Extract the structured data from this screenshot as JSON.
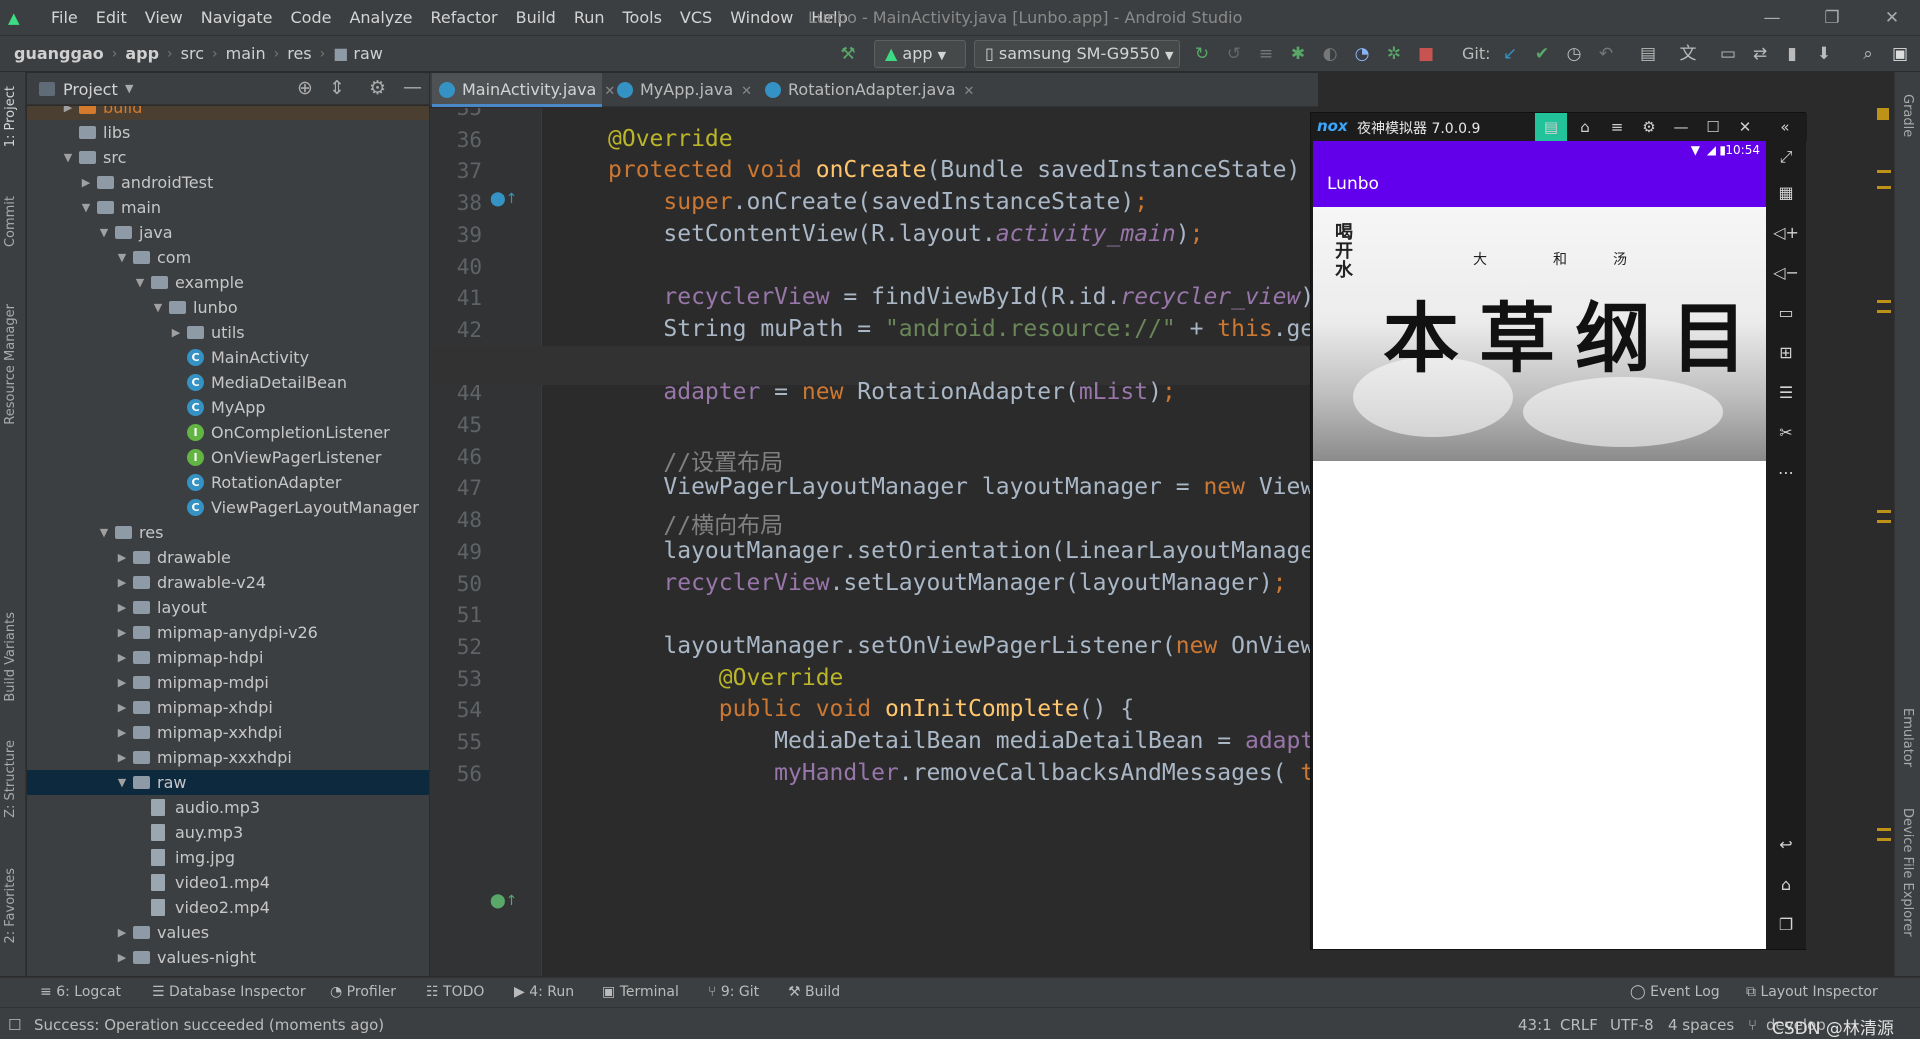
{
  "window": {
    "title": "Lunbo - MainActivity.java [Lunbo.app] - Android Studio",
    "menu": [
      "File",
      "Edit",
      "View",
      "Navigate",
      "Code",
      "Analyze",
      "Refactor",
      "Build",
      "Run",
      "Tools",
      "VCS",
      "Window",
      "Help"
    ]
  },
  "nav": {
    "breadcrumb": [
      "guanggao",
      "app",
      "src",
      "main",
      "res",
      "raw"
    ],
    "run_config": "app",
    "device": "samsung SM-G9550",
    "git_label": "Git:"
  },
  "left_strip": [
    "1: Project",
    "Commit",
    "Resource Manager",
    "Build Variants",
    "Z: Structure",
    "2: Favorites"
  ],
  "right_strip": [
    "Gradle",
    "Emulator",
    "Device File Explorer"
  ],
  "project_panel": {
    "title": "Project",
    "tree": [
      {
        "label": "build",
        "kind": "folder-orange",
        "depth": 2,
        "arrow": "right",
        "highlight": true
      },
      {
        "label": "libs",
        "kind": "folder",
        "depth": 2,
        "arrow": ""
      },
      {
        "label": "src",
        "kind": "folder",
        "depth": 2,
        "arrow": "down"
      },
      {
        "label": "androidTest",
        "kind": "folder",
        "depth": 3,
        "arrow": "right"
      },
      {
        "label": "main",
        "kind": "folder",
        "depth": 3,
        "arrow": "down"
      },
      {
        "label": "java",
        "kind": "folder",
        "depth": 4,
        "arrow": "down"
      },
      {
        "label": "com",
        "kind": "folder",
        "depth": 5,
        "arrow": "down"
      },
      {
        "label": "example",
        "kind": "folder",
        "depth": 6,
        "arrow": "down"
      },
      {
        "label": "lunbo",
        "kind": "folder",
        "depth": 7,
        "arrow": "down"
      },
      {
        "label": "utils",
        "kind": "folder",
        "depth": 8,
        "arrow": "right"
      },
      {
        "label": "MainActivity",
        "kind": "class",
        "depth": 8,
        "arrow": ""
      },
      {
        "label": "MediaDetailBean",
        "kind": "class",
        "depth": 8,
        "arrow": ""
      },
      {
        "label": "MyApp",
        "kind": "class",
        "depth": 8,
        "arrow": ""
      },
      {
        "label": "OnCompletionListener",
        "kind": "interface",
        "depth": 8,
        "arrow": ""
      },
      {
        "label": "OnViewPagerListener",
        "kind": "interface",
        "depth": 8,
        "arrow": ""
      },
      {
        "label": "RotationAdapter",
        "kind": "class",
        "depth": 8,
        "arrow": ""
      },
      {
        "label": "ViewPagerLayoutManager",
        "kind": "class",
        "depth": 8,
        "arrow": ""
      },
      {
        "label": "res",
        "kind": "folder",
        "depth": 4,
        "arrow": "down"
      },
      {
        "label": "drawable",
        "kind": "folder",
        "depth": 5,
        "arrow": "right"
      },
      {
        "label": "drawable-v24",
        "kind": "folder",
        "depth": 5,
        "arrow": "right"
      },
      {
        "label": "layout",
        "kind": "folder",
        "depth": 5,
        "arrow": "right"
      },
      {
        "label": "mipmap-anydpi-v26",
        "kind": "folder",
        "depth": 5,
        "arrow": "right"
      },
      {
        "label": "mipmap-hdpi",
        "kind": "folder",
        "depth": 5,
        "arrow": "right"
      },
      {
        "label": "mipmap-mdpi",
        "kind": "folder",
        "depth": 5,
        "arrow": "right"
      },
      {
        "label": "mipmap-xhdpi",
        "kind": "folder",
        "depth": 5,
        "arrow": "right"
      },
      {
        "label": "mipmap-xxhdpi",
        "kind": "folder",
        "depth": 5,
        "arrow": "right"
      },
      {
        "label": "mipmap-xxxhdpi",
        "kind": "folder",
        "depth": 5,
        "arrow": "right"
      },
      {
        "label": "raw",
        "kind": "folder",
        "depth": 5,
        "arrow": "down",
        "selected": true
      },
      {
        "label": "audio.mp3",
        "kind": "file",
        "depth": 6,
        "arrow": ""
      },
      {
        "label": "auy.mp3",
        "kind": "file",
        "depth": 6,
        "arrow": ""
      },
      {
        "label": "img.jpg",
        "kind": "file",
        "depth": 6,
        "arrow": ""
      },
      {
        "label": "video1.mp4",
        "kind": "file",
        "depth": 6,
        "arrow": ""
      },
      {
        "label": "video2.mp4",
        "kind": "file",
        "depth": 6,
        "arrow": ""
      },
      {
        "label": "values",
        "kind": "folder",
        "depth": 5,
        "arrow": "right"
      },
      {
        "label": "values-night",
        "kind": "folder",
        "depth": 5,
        "arrow": "right"
      }
    ]
  },
  "editor": {
    "tabs": [
      {
        "label": "MainActivity.java",
        "active": true
      },
      {
        "label": "MyApp.java",
        "active": false
      },
      {
        "label": "RotationAdapter.java",
        "active": false
      }
    ],
    "current_line": 43,
    "lines": [
      {
        "n": 35,
        "html": ""
      },
      {
        "n": 36,
        "html": "<span class='an'>@Override</span>"
      },
      {
        "n": 37,
        "html": "<span class='k'>protected void </span><span class='fn'>onCreate</span>(Bundle savedInstanceState) {"
      },
      {
        "n": 38,
        "html": "    <span class='k'>super</span>.onCreate(savedInstanceState)<span class='k'>;</span>"
      },
      {
        "n": 39,
        "html": "    setContentView(R.layout.<span class='fld it'>activity_main</span>)<span class='k'>;</span>"
      },
      {
        "n": 40,
        "html": ""
      },
      {
        "n": 41,
        "html": "    <span class='fld'>recyclerView</span> = findViewById(R.id.<span class='fld it'>recycler_view</span>)<span class='k'>;</span>"
      },
      {
        "n": 42,
        "html": "    String muPath = <span class='str'>\"android.resource://\"</span> + <span class='k'>this</span>.getPackageName()"
      },
      {
        "n": 43,
        "html": ""
      },
      {
        "n": 44,
        "html": "    <span class='fld'>adapter</span> = <span class='k'>new </span>RotationAdapter(<span class='fld'>mList</span>)<span class='k'>;</span>"
      },
      {
        "n": 45,
        "html": ""
      },
      {
        "n": 46,
        "html": "    <span class='cm'>//设置布局</span>"
      },
      {
        "n": 47,
        "html": "    ViewPagerLayoutManager layoutManager = <span class='k'>new </span>ViewPagerLayoutManager("
      },
      {
        "n": 48,
        "html": "    <span class='cm'>//横向布局</span>"
      },
      {
        "n": 49,
        "html": "    layoutManager.setOrientation(LinearLayoutManager.<span class='fld it'>HORIZONTAL</span>)<span class='k'>;</span>"
      },
      {
        "n": 50,
        "html": "    <span class='fld'>recyclerView</span>.setLayoutManager(layoutManager)<span class='k'>;</span>"
      },
      {
        "n": 51,
        "html": ""
      },
      {
        "n": 52,
        "html": "    layoutManager.setOnViewPagerListener(<span class='k'>new </span>OnViewPagerListener() {"
      },
      {
        "n": 53,
        "html": "        <span class='an'>@Override</span>"
      },
      {
        "n": 54,
        "html": "        <span class='k'>public void </span><span class='fn'>onInitComplete</span>() {"
      },
      {
        "n": 55,
        "html": "            MediaDetailBean mediaDetailBean = <span class='fld'>adapter</span>.getItem("
      },
      {
        "n": 56,
        "html": "            <span class='fld'>myHandler</span>.removeCallbacksAndMessages( <span class='k'>t</span>"
      }
    ]
  },
  "emulator": {
    "brand": "nox",
    "name": "夜神模拟器 7.0.0.9",
    "time": "10:54",
    "app_title": "Lunbo",
    "banner": {
      "main_text": "本草纲目",
      "small_texts": [
        "大",
        "和",
        "汤"
      ],
      "side_text": "喝开水"
    }
  },
  "bottom_tools": [
    "6: Logcat",
    "Database Inspector",
    "Profiler",
    "TODO",
    "4: Run",
    "Terminal",
    "9: Git",
    "Build"
  ],
  "bottom_tools_right": [
    "Event Log",
    "Layout Inspector"
  ],
  "status": {
    "message": "Success: Operation succeeded (moments ago)",
    "position": "43:1",
    "line_ending": "CRLF",
    "encoding": "UTF-8",
    "indent": "4 spaces",
    "branch": "develop",
    "watermark": "CSDN @林清源"
  }
}
